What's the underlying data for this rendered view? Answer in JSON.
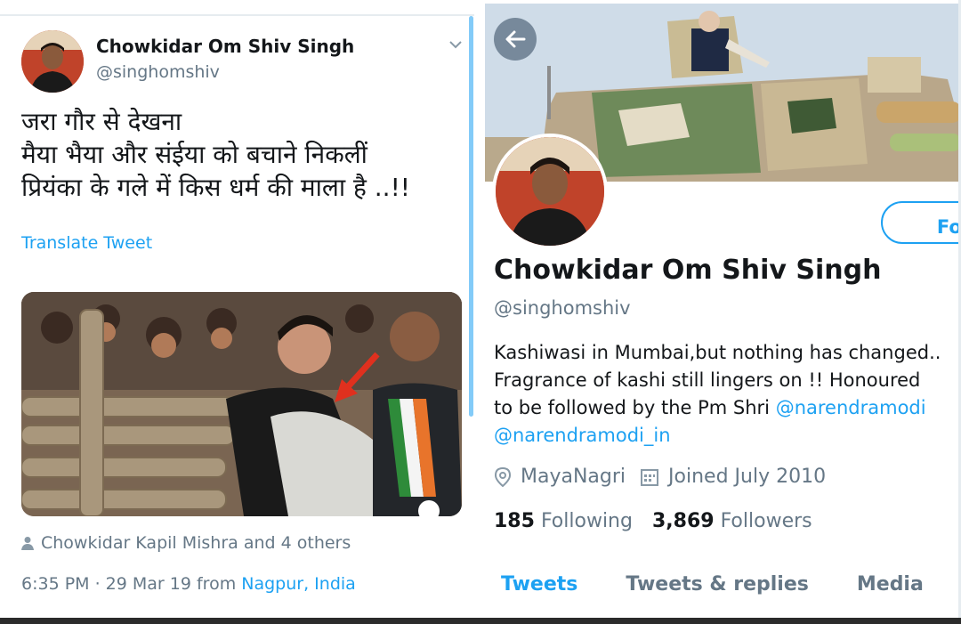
{
  "tweet": {
    "author_name": "Chowkidar Om Shiv Singh",
    "author_handle": "@singhomshiv",
    "text_lines": [
      "जरा गौर से देखना",
      "मैया भैया और संईया को बचाने निकलीं",
      "प्रियंका के गले में किस धर्म की माला है ..!!"
    ],
    "translate_label": "Translate Tweet",
    "liked_by": "Chowkidar Kapil Mishra and 4 others",
    "time_date": "6:35 PM · 29 Mar 19 from ",
    "place": "Nagpur, India"
  },
  "profile": {
    "follow_label": "Foll",
    "name": "Chowkidar Om Shiv Singh",
    "handle": "@singhomshiv",
    "bio_lines": [
      "Kashiwasi in Mumbai,but nothing has changed..",
      "Fragrance of kashi still lingers on !! Honoured"
    ],
    "bio_line3_prefix": "to be followed by the Pm Shri ",
    "bio_mention1": "@narendramodi",
    "bio_mention2": "@narendramodi_in",
    "location": "MayaNagri",
    "joined": "Joined July 2010",
    "following_count": "185",
    "following_label": "Following",
    "followers_count": "3,869",
    "followers_label": "Followers",
    "tabs": [
      "Tweets",
      "Tweets & replies",
      "Media"
    ]
  },
  "colors": {
    "accent": "#1da1f2",
    "secondary_text": "#657786",
    "primary_text": "#14171a"
  },
  "icons": [
    "chevron-down-icon",
    "person-icon",
    "back-arrow-icon",
    "location-pin-icon",
    "calendar-icon"
  ]
}
